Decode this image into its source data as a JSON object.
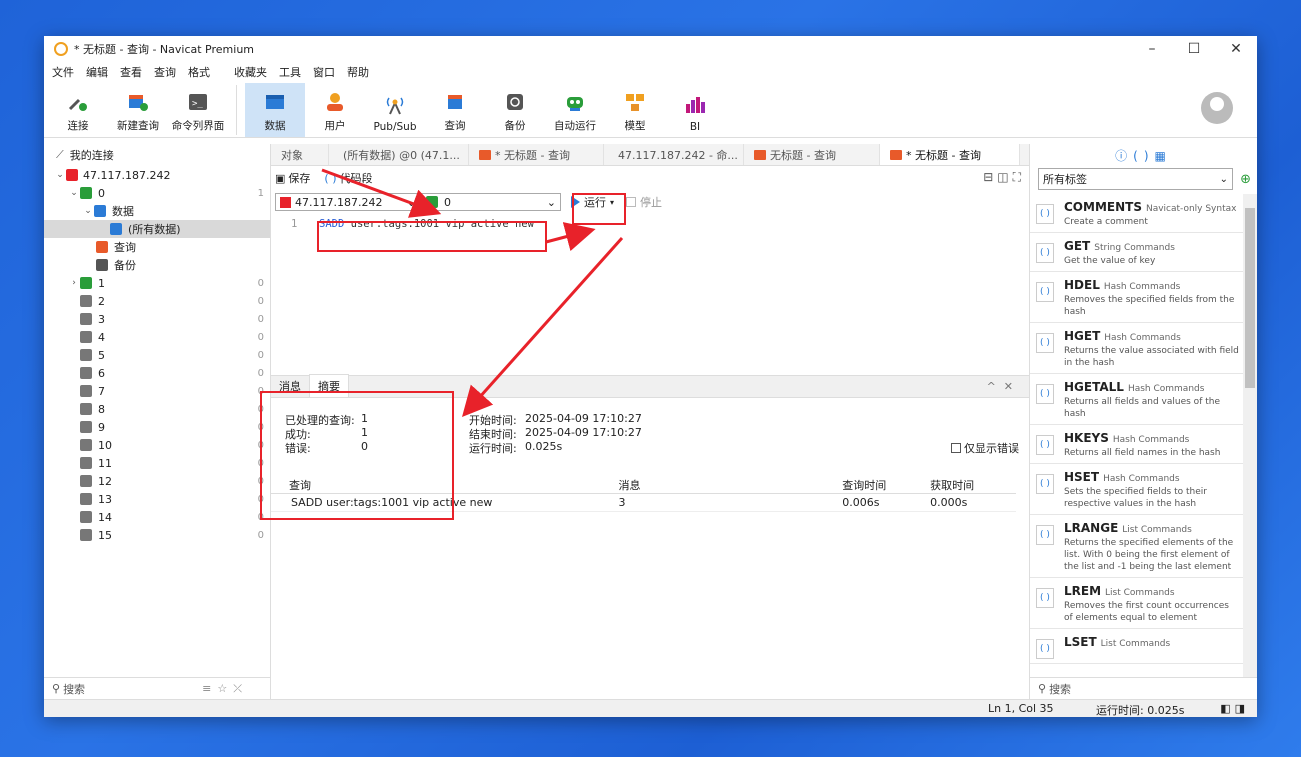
{
  "window": {
    "title": "* 无标题 - 查询 - Navicat Premium",
    "controls": [
      "–",
      "☐",
      "✕"
    ]
  },
  "menu": [
    "文件",
    "编辑",
    "查看",
    "查询",
    "格式",
    "收藏夹",
    "工具",
    "窗口",
    "帮助"
  ],
  "toolbar": {
    "left": [
      {
        "label": "连接",
        "icon": "connect-icon"
      },
      {
        "label": "新建查询",
        "icon": "new-query-icon"
      },
      {
        "label": "命令列界面",
        "icon": "console-icon"
      }
    ],
    "main": [
      {
        "label": "数据",
        "icon": "data-icon",
        "active": true
      },
      {
        "label": "用户",
        "icon": "user-icon"
      },
      {
        "label": "Pub/Sub",
        "icon": "pubsub-icon"
      },
      {
        "label": "查询",
        "icon": "query-icon"
      },
      {
        "label": "备份",
        "icon": "backup-icon"
      },
      {
        "label": "自动运行",
        "icon": "robot-icon"
      },
      {
        "label": "模型",
        "icon": "model-icon"
      },
      {
        "label": "BI",
        "icon": "bi-icon"
      }
    ]
  },
  "sidebar": {
    "header": "我的连接",
    "connection": "47.117.187.242",
    "db0": {
      "label": "0",
      "count": "1"
    },
    "data_label": "数据",
    "all_data": "(所有数据)",
    "query_label": "查询",
    "backup_label": "备份",
    "dbs": [
      {
        "label": "1",
        "count": "0"
      },
      {
        "label": "2",
        "count": "0"
      },
      {
        "label": "3",
        "count": "0"
      },
      {
        "label": "4",
        "count": "0"
      },
      {
        "label": "5",
        "count": "0"
      },
      {
        "label": "6",
        "count": "0"
      },
      {
        "label": "7",
        "count": "0"
      },
      {
        "label": "8",
        "count": "0"
      },
      {
        "label": "9",
        "count": "0"
      },
      {
        "label": "10",
        "count": "0"
      },
      {
        "label": "11",
        "count": "0"
      },
      {
        "label": "12",
        "count": "0"
      },
      {
        "label": "13",
        "count": "0"
      },
      {
        "label": "14",
        "count": "0"
      },
      {
        "label": "15",
        "count": "0"
      }
    ],
    "search_placeholder": "搜索"
  },
  "tabs": [
    "对象",
    "(所有数据) @0 (47.1...",
    "* 无标题 - 查询",
    "47.117.187.242 - 命...",
    "无标题 - 查询",
    "* 无标题 - 查询"
  ],
  "query": {
    "save": "保存",
    "snippet": "代码段",
    "connection": "47.117.187.242",
    "db": "0",
    "run": "运行",
    "stop": "停止",
    "line": "1",
    "code_cmd": "SADD",
    "code_rest": " user:tags:1001 vip active new"
  },
  "result": {
    "tabs": [
      "消息",
      "摘要"
    ],
    "processed_label": "已处理的查询:",
    "processed": "1",
    "success_label": "成功:",
    "success": "1",
    "error_label": "错误:",
    "error": "0",
    "start_label": "开始时间:",
    "start": "2025-04-09 17:10:27",
    "end_label": "结束时间:",
    "end": "2025-04-09 17:10:27",
    "run_label": "运行时间:",
    "run": "0.025s",
    "only_errors": "仅显示错误",
    "columns": [
      "查询",
      "消息",
      "查询时间",
      "获取时间"
    ],
    "rows": [
      [
        "SADD user:tags:1001 vip active new",
        "3",
        "0.006s",
        "0.000s"
      ]
    ]
  },
  "right_panel": {
    "filter": "所有标签",
    "commands": [
      {
        "name": "COMMENTS",
        "group": "Navicat-only Syntax",
        "desc": "Create a comment"
      },
      {
        "name": "GET",
        "group": "String Commands",
        "desc": "Get the value of key"
      },
      {
        "name": "HDEL",
        "group": "Hash Commands",
        "desc": "Removes the specified fields from the hash"
      },
      {
        "name": "HGET",
        "group": "Hash Commands",
        "desc": "Returns the value associated with field in the hash"
      },
      {
        "name": "HGETALL",
        "group": "Hash Commands",
        "desc": "Returns all fields and values of the hash"
      },
      {
        "name": "HKEYS",
        "group": "Hash Commands",
        "desc": "Returns all field names in the hash"
      },
      {
        "name": "HSET",
        "group": "Hash Commands",
        "desc": "Sets the specified fields to their respective values in the hash"
      },
      {
        "name": "LRANGE",
        "group": "List Commands",
        "desc": "Returns the specified elements of the list. With 0 being the first element of the list and -1 being the last element"
      },
      {
        "name": "LREM",
        "group": "List Commands",
        "desc": "Removes the first count occurrences of elements equal to element"
      },
      {
        "name": "LSET",
        "group": "List Commands",
        "desc": ""
      }
    ],
    "search_placeholder": "搜索"
  },
  "status": {
    "position": "Ln 1, Col 35",
    "time": "运行时间: 0.025s"
  },
  "colors": {
    "accent": "#2b7bd6",
    "annotation": "#e8222a",
    "active_tab": "#cfe3f7"
  }
}
